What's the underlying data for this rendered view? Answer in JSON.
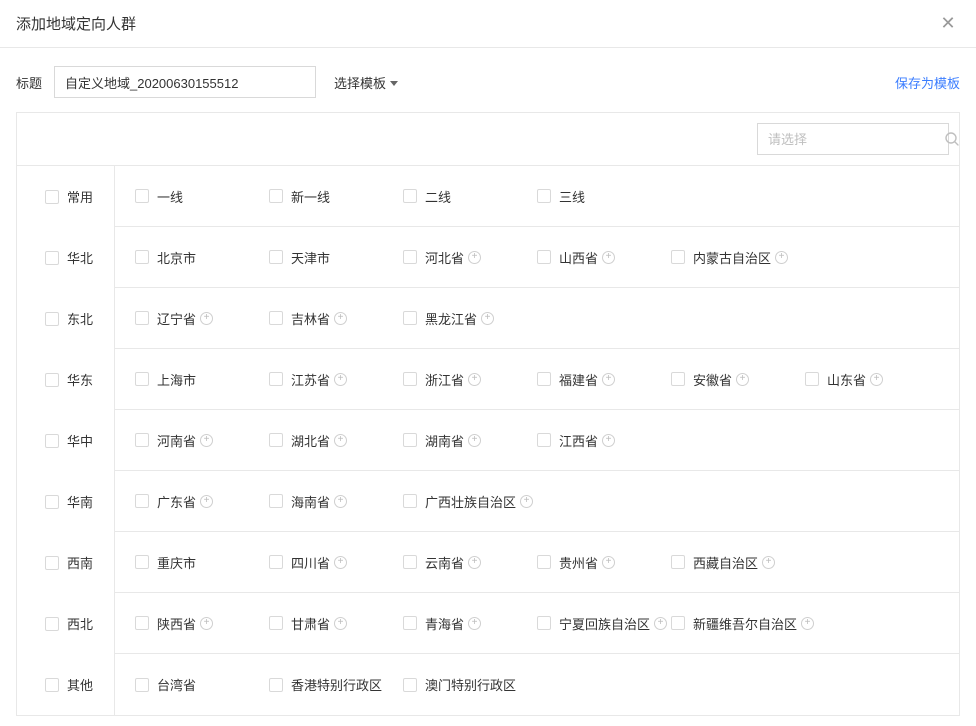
{
  "dialog": {
    "title": "添加地域定向人群",
    "close": "✕"
  },
  "header": {
    "titleLabel": "标题",
    "titleValue": "自定义地域_20200630155512",
    "templateLabel": "选择模板",
    "saveTemplate": "保存为模板"
  },
  "search": {
    "placeholder": "请选择"
  },
  "categories": [
    {
      "name": "常用",
      "items": [
        {
          "label": "一线",
          "expandable": false
        },
        {
          "label": "新一线",
          "expandable": false
        },
        {
          "label": "二线",
          "expandable": false
        },
        {
          "label": "三线",
          "expandable": false
        }
      ]
    },
    {
      "name": "华北",
      "items": [
        {
          "label": "北京市",
          "expandable": false
        },
        {
          "label": "天津市",
          "expandable": false
        },
        {
          "label": "河北省",
          "expandable": true
        },
        {
          "label": "山西省",
          "expandable": true
        },
        {
          "label": "内蒙古自治区",
          "expandable": true
        }
      ]
    },
    {
      "name": "东北",
      "items": [
        {
          "label": "辽宁省",
          "expandable": true
        },
        {
          "label": "吉林省",
          "expandable": true
        },
        {
          "label": "黑龙江省",
          "expandable": true
        }
      ]
    },
    {
      "name": "华东",
      "items": [
        {
          "label": "上海市",
          "expandable": false
        },
        {
          "label": "江苏省",
          "expandable": true
        },
        {
          "label": "浙江省",
          "expandable": true
        },
        {
          "label": "福建省",
          "expandable": true
        },
        {
          "label": "安徽省",
          "expandable": true
        },
        {
          "label": "山东省",
          "expandable": true
        }
      ]
    },
    {
      "name": "华中",
      "items": [
        {
          "label": "河南省",
          "expandable": true
        },
        {
          "label": "湖北省",
          "expandable": true
        },
        {
          "label": "湖南省",
          "expandable": true
        },
        {
          "label": "江西省",
          "expandable": true
        }
      ]
    },
    {
      "name": "华南",
      "items": [
        {
          "label": "广东省",
          "expandable": true
        },
        {
          "label": "海南省",
          "expandable": true
        },
        {
          "label": "广西壮族自治区",
          "expandable": true,
          "wide": true
        }
      ]
    },
    {
      "name": "西南",
      "items": [
        {
          "label": "重庆市",
          "expandable": false
        },
        {
          "label": "四川省",
          "expandable": true
        },
        {
          "label": "云南省",
          "expandable": true
        },
        {
          "label": "贵州省",
          "expandable": true
        },
        {
          "label": "西藏自治区",
          "expandable": true
        }
      ]
    },
    {
      "name": "西北",
      "items": [
        {
          "label": "陕西省",
          "expandable": true
        },
        {
          "label": "甘肃省",
          "expandable": true
        },
        {
          "label": "青海省",
          "expandable": true
        },
        {
          "label": "宁夏回族自治区",
          "expandable": true
        },
        {
          "label": "新疆维吾尔自治区",
          "expandable": true,
          "wide": true
        }
      ]
    },
    {
      "name": "其他",
      "items": [
        {
          "label": "台湾省",
          "expandable": false
        },
        {
          "label": "香港特别行政区",
          "expandable": false
        },
        {
          "label": "澳门特别行政区",
          "expandable": false
        }
      ]
    }
  ]
}
